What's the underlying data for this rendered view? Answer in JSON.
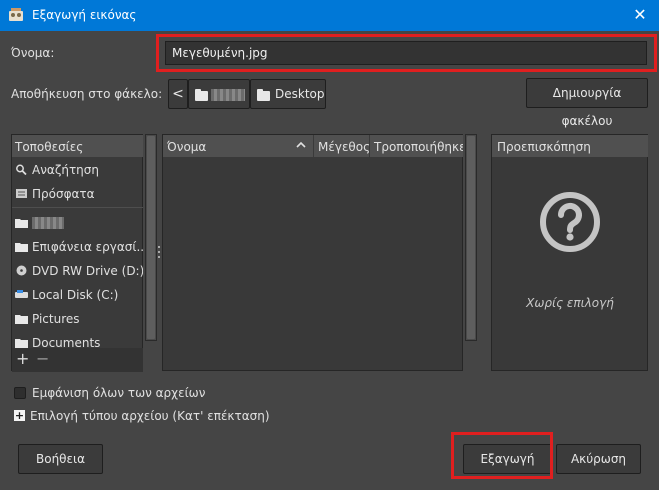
{
  "window": {
    "title": "Εξαγωγή εικόνας"
  },
  "name_label": "Όνομα:",
  "filename": "Μεγεθυμένη.jpg",
  "save_in_label": "Αποθήκευση στο φάκελο:",
  "breadcrumb": {
    "back": "<",
    "current": "Desktop"
  },
  "new_folder_label": "Δημιουργία φακέλου",
  "places": {
    "header": "Τοποθεσίες",
    "items": [
      {
        "label": "Αναζήτηση",
        "icon": "search-icon"
      },
      {
        "label": "Πρόσφατα",
        "icon": "recent-icon"
      },
      {
        "label": "",
        "icon": "folder-icon"
      },
      {
        "label": "Επιφάνεια εργασί...",
        "icon": "folder-icon"
      },
      {
        "label": "DVD RW Drive (D:)",
        "icon": "dvd-icon"
      },
      {
        "label": "Local Disk (C:)",
        "icon": "disk-icon"
      },
      {
        "label": "Pictures",
        "icon": "folder-icon"
      },
      {
        "label": "Documents",
        "icon": "folder-icon"
      }
    ],
    "add": "+",
    "remove": "−"
  },
  "files": {
    "columns": [
      "Όνομα",
      "Μέγεθος",
      "Τροποποιήθηκε"
    ],
    "sort_indicator": "^"
  },
  "preview": {
    "header": "Προεπισκόπηση",
    "empty_text": "Χωρίς επιλογή"
  },
  "show_all_files_label": "Εμφάνιση όλων των αρχείων",
  "file_type_label": "Επιλογή τύπου αρχείου (Κατ' επέκταση)",
  "file_type_expander": "+",
  "buttons": {
    "help": "Βοήθεια",
    "export": "Εξαγωγή",
    "cancel": "Ακύρωση"
  },
  "colors": {
    "titlebar": "#0078d7",
    "highlight": "#e01f1f",
    "background": "#454545"
  }
}
